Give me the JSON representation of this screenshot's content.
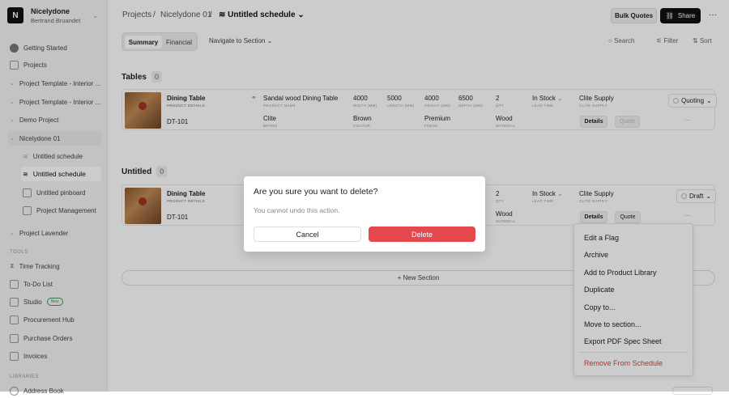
{
  "workspace": {
    "initial": "N",
    "name": "Nicelydone",
    "user": "Bertrand Bruandet"
  },
  "sidebar": {
    "items": [
      {
        "label": "Getting Started"
      },
      {
        "label": "Projects"
      },
      {
        "label": "Project Template - Interior ..."
      },
      {
        "label": "Project Template - Interior ..."
      },
      {
        "label": "Demo Project"
      },
      {
        "label": "Nicelydone 01"
      },
      {
        "label": "Untitled schedule"
      },
      {
        "label": "Untitled schedule"
      },
      {
        "label": "Untitled pinboard"
      },
      {
        "label": "Project Management"
      },
      {
        "label": "Project Lavender"
      }
    ],
    "tools_label": "TOOLS",
    "tools": [
      {
        "label": "Time Tracking"
      },
      {
        "label": "To-Do List"
      },
      {
        "label": "Studio",
        "badge": "New"
      },
      {
        "label": "Procurement Hub"
      },
      {
        "label": "Purchase Orders"
      },
      {
        "label": "Invoices"
      }
    ],
    "libraries_label": "LIBRARIES",
    "libraries": [
      {
        "label": "Address Book"
      }
    ]
  },
  "breadcrumb": [
    "Projects",
    "/",
    "Nicelydone 01",
    "/",
    "Untitled schedule"
  ],
  "header": {
    "bulk_quotes": "Bulk Quotes",
    "share": "Share",
    "more": "···"
  },
  "tabs": [
    "Summary",
    "Financial"
  ],
  "navigate": "Navigate to Section",
  "toolbar": {
    "search": "Search",
    "filter": "Filter",
    "sort": "Sort"
  },
  "sections": [
    {
      "title": "Tables",
      "count": "0",
      "row": {
        "name": "Dining Table",
        "name_label": "PRODUCT DETAILS",
        "code": "DT-101",
        "product_name": "Sandal wood Dining Table",
        "product_name_label": "PRODUCT NAME",
        "width": "4000",
        "width_label": "WIDTH (MM)",
        "length": "5000",
        "length_label": "LENGTH (MM)",
        "height": "4000",
        "height_label": "HEIGHT (MM)",
        "depth": "6500",
        "depth_label": "DEPTH (MM)",
        "qty": "2",
        "qty_label": "QTY",
        "lead": "In Stock",
        "lead_label": "LEAD TIME",
        "supplier": "Clite Supply",
        "supplier_label": "CLITE SUPPLY",
        "brand": "Clite",
        "brand_label": "BRAND",
        "colour": "Brown",
        "colour_label": "COLOUR",
        "finish": "Premium",
        "finish_label": "FINISH",
        "material": "Wood",
        "material_label": "MATERIAL",
        "status": "Quoting",
        "details": "Details",
        "quote": "Quote",
        "more": "···"
      }
    },
    {
      "title": "Untitled",
      "count": "0",
      "row": {
        "name": "Dining Table",
        "name_label": "PRODUCT DETAILS",
        "code": "DT-101",
        "qty": "2",
        "qty_label": "QTY",
        "lead": "In Stock",
        "lead_label": "LEAD TIME",
        "supplier": "Clite Supply",
        "supplier_label": "CLITE SUPPLY",
        "material": "Wood",
        "material_label": "MATERIAL",
        "status": "Draft",
        "details": "Details",
        "quote": "Quote",
        "more": "···"
      }
    }
  ],
  "new_section": "+ New Section",
  "modal": {
    "title": "Are you sure you want to delete?",
    "message": "You cannot undo this action.",
    "cancel": "Cancel",
    "delete": "Delete"
  },
  "menu": {
    "items": [
      "Edit a Flag",
      "Archive",
      "Add to Product Library",
      "Duplicate",
      "Copy to...",
      "Move to section...",
      "Export PDF Spec Sheet"
    ],
    "danger": "Remove From Schedule"
  },
  "colors": {
    "danger": "#e5484d",
    "dark": "#111111"
  }
}
